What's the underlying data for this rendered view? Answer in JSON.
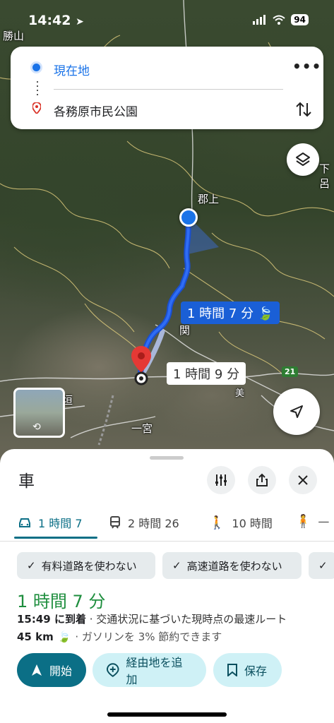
{
  "status_bar": {
    "time": "14:42",
    "battery": "94"
  },
  "map": {
    "labels": [
      "勝山",
      "郡上",
      "関",
      "一宮",
      "下呂",
      "垣",
      "美"
    ],
    "route_badges": {
      "primary": "1 時間 7 分",
      "alternative": "1 時間 9 分"
    },
    "road_shield": "21"
  },
  "search": {
    "origin": "現在地",
    "destination": "各務原市民公園"
  },
  "sheet": {
    "title": "車",
    "tabs": [
      {
        "label": "1 時間 7",
        "icon": "car-icon"
      },
      {
        "label": "2 時間 26",
        "icon": "transit-icon"
      },
      {
        "label": "10 時間",
        "icon": "walk-icon"
      },
      {
        "label": "—",
        "icon": "hike-icon"
      }
    ],
    "chips": [
      "有料道路を使わない",
      "高速道路を使わない"
    ],
    "eta": "1 時間 7 分",
    "arrival_time": "15:49 に到着",
    "arrival_note": " · 交通状況に基づいた現時点の最速ルート",
    "distance": "45 km",
    "fuel_note": " · ガソリンを 3% 節約できます",
    "buttons": {
      "start": "開始",
      "add_stop": "経由地を追加",
      "save": "保存"
    }
  },
  "colors": {
    "accent": "#0b6f86",
    "route": "#1a5fd6",
    "eta_green": "#1e8e3e"
  }
}
